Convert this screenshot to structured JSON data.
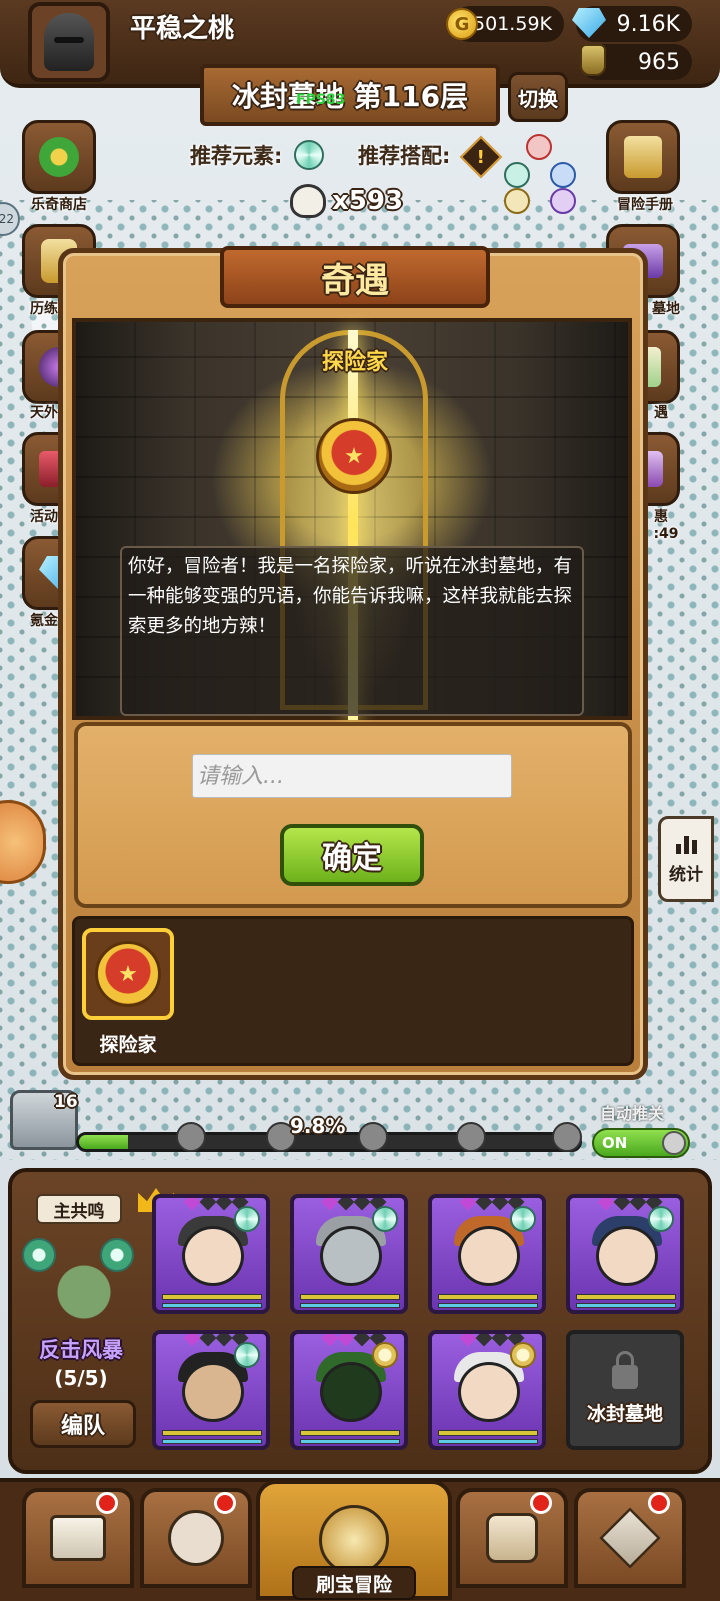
{
  "header": {
    "player_name": "平稳之桃",
    "gold": "501.59K",
    "gems": "9.16K",
    "potions": "965",
    "stage_title": "冰封墓地 第116层",
    "fps": "FPS83",
    "switch_label": "切换",
    "recommended_element_label": "推荐元素:",
    "recommended_combo_label": "推荐搭配:",
    "enemy_count": "x593"
  },
  "left_menu": [
    {
      "label": "乐奇商店"
    },
    {
      "label": "历练"
    },
    {
      "label": "天外"
    },
    {
      "label": "活动"
    },
    {
      "label": "氪金"
    }
  ],
  "right_menu": [
    {
      "label": "冒险手册"
    },
    {
      "label": "墓地"
    },
    {
      "label": "遇"
    },
    {
      "label": "惠"
    },
    {
      "label": ":49"
    }
  ],
  "left_badge": "22",
  "dialog": {
    "title": "奇遇",
    "npc_name": "探险家",
    "message": "你好，冒险者！我是一名探险家，听说在冰封墓地，有一种能够变强的咒语，你能告诉我嘛，这样我就能去探索更多的地方辣！",
    "input_placeholder": "请输入...",
    "confirm_label": "确定",
    "npc_list": [
      {
        "label": "探险家"
      }
    ]
  },
  "progress": {
    "chest_count": "16",
    "percent_text": "9.8%",
    "percent_value": 9.8,
    "auto_push_label": "自动推关",
    "toggle_state": "ON"
  },
  "stats_label": "统计",
  "team": {
    "lord_tag": "主共鸣",
    "formation_name": "反击风暴",
    "formation_count": "(5/5)",
    "edit_label": "编队",
    "locked_label": "冰封墓地"
  },
  "bottom_nav": {
    "main_label": "刷宝冒险"
  },
  "colors": {
    "accent_gold": "#ffd94a",
    "button_green": "#6db21b",
    "wood_brown": "#5a3516",
    "hero_purple": "#9a5fe0"
  }
}
